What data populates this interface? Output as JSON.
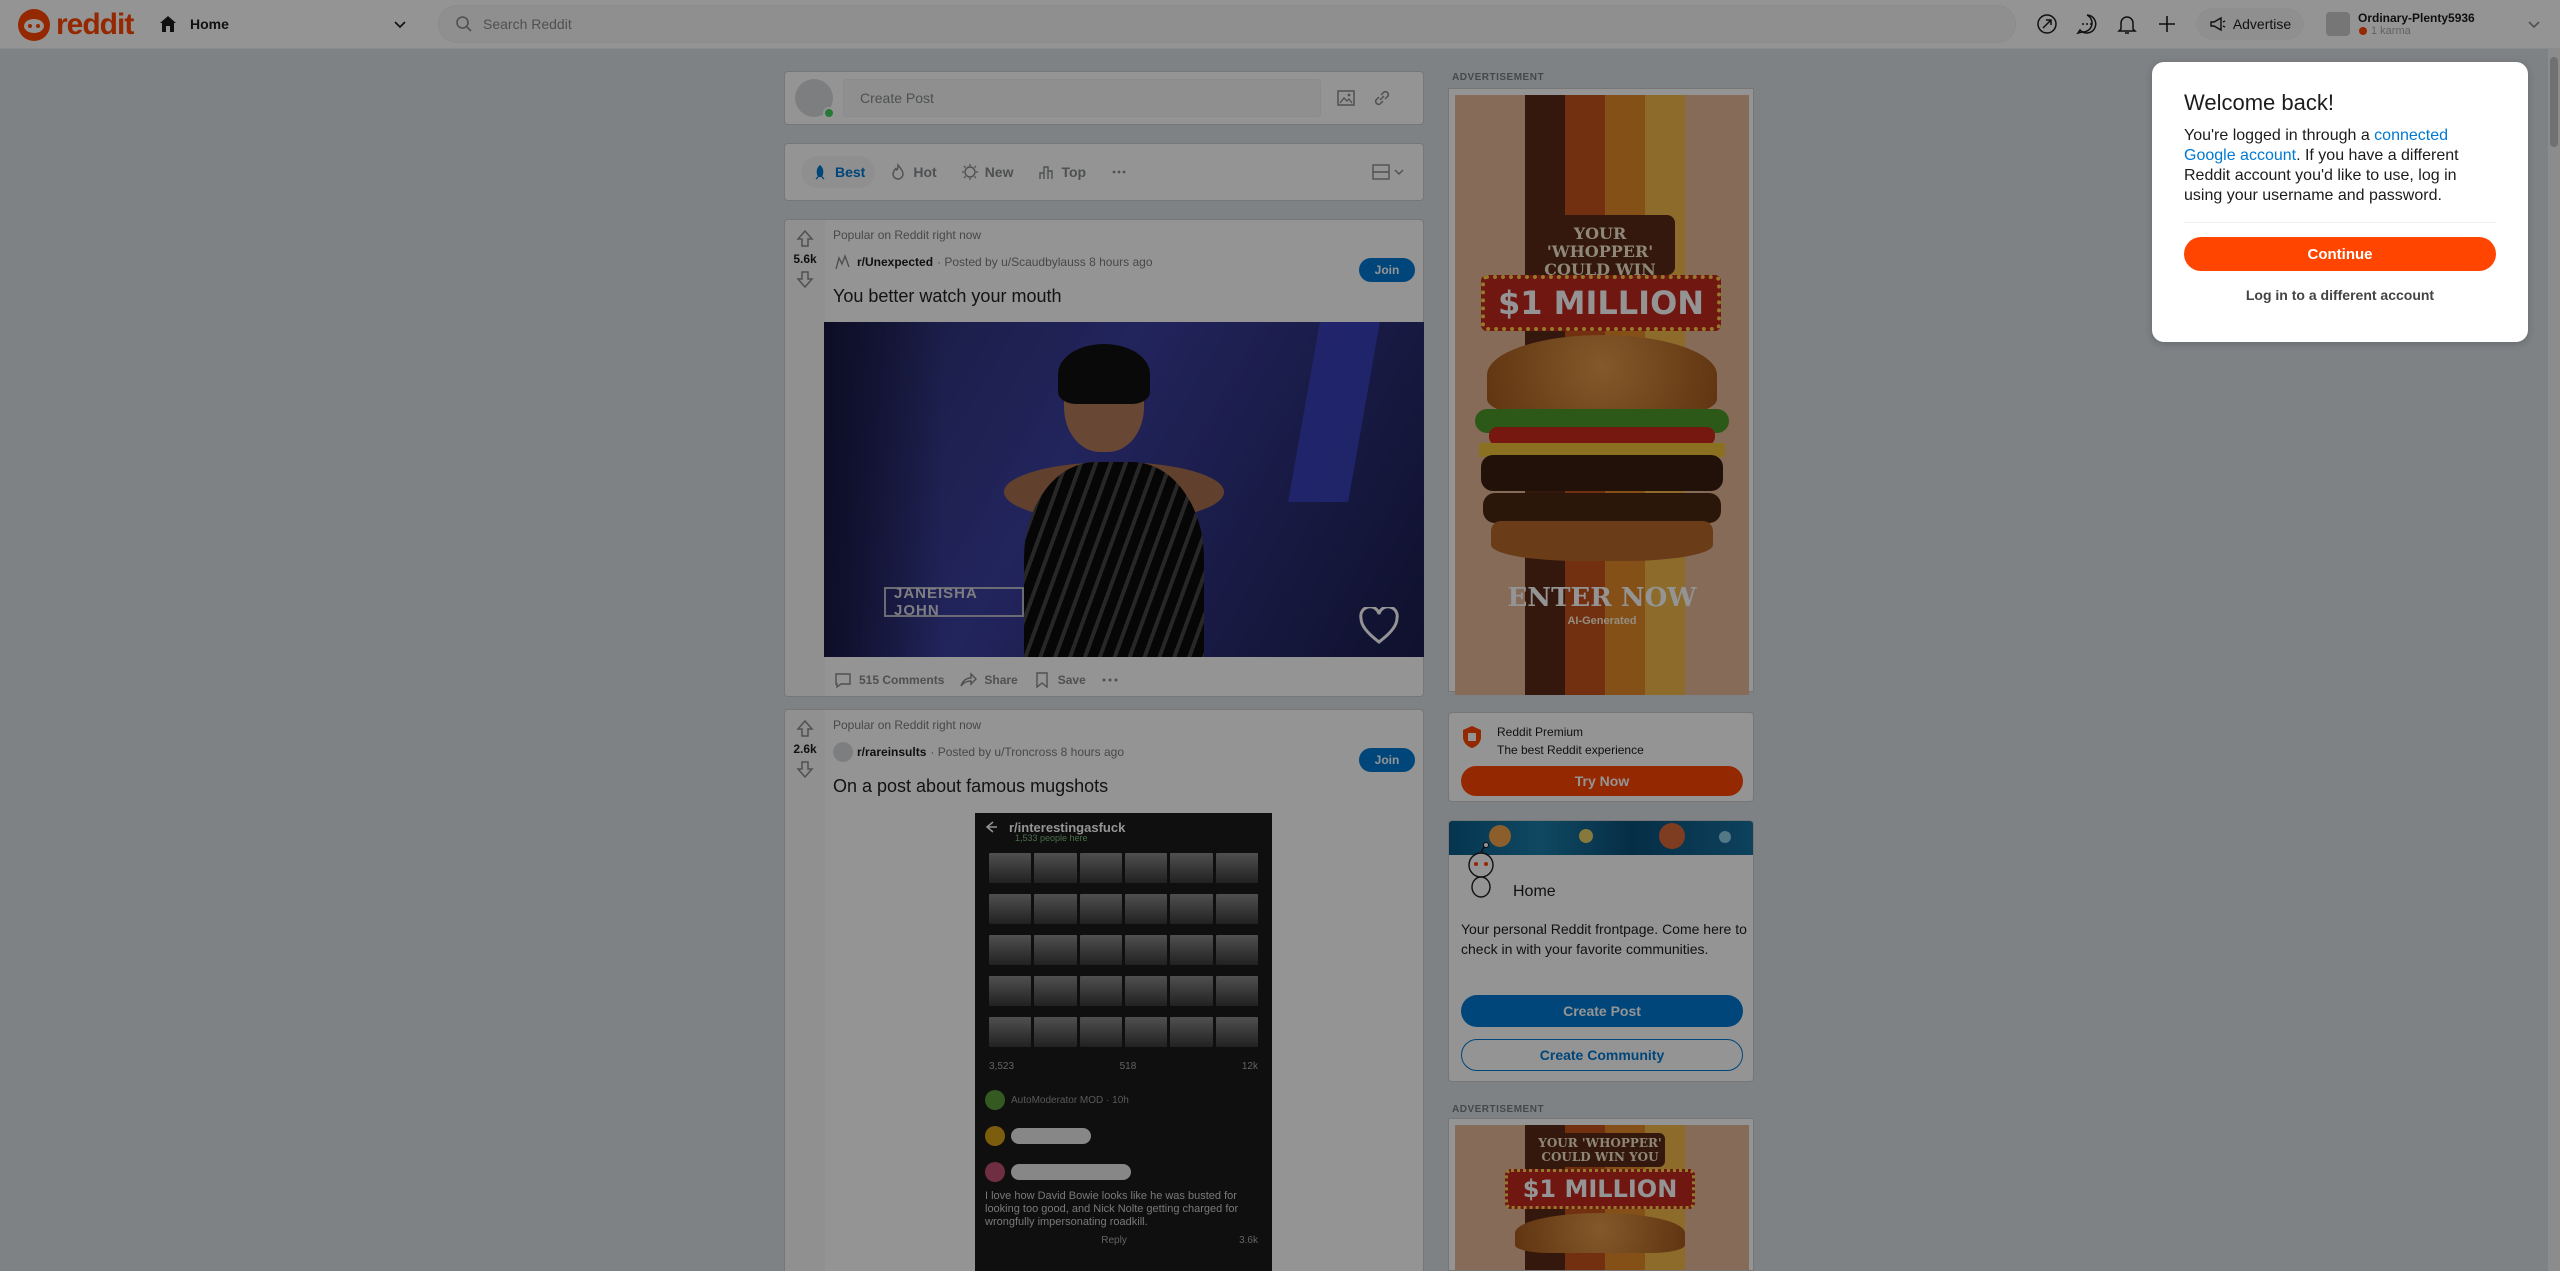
{
  "header": {
    "logo_text": "reddit",
    "home_label": "Home",
    "search_placeholder": "Search Reddit",
    "advertise_label": "Advertise",
    "username": "Ordinary-Plenty5936",
    "karma": "1 karma"
  },
  "create_post": {
    "placeholder": "Create Post"
  },
  "sort": {
    "items": [
      "Best",
      "Hot",
      "New",
      "Top"
    ],
    "active": "Best"
  },
  "posts": [
    {
      "label": "Popular on Reddit right now",
      "votes": "5.6k",
      "subreddit": "r/Unexpected",
      "posted_by": "· Posted by u/Scaudbylauss 8 hours ago",
      "join": "Join",
      "title": "You better watch your mouth",
      "video_caption": "JANEISHA JOHN",
      "comments": "515 Comments",
      "share": "Share",
      "save": "Save"
    },
    {
      "label": "Popular on Reddit right now",
      "votes": "2.6k",
      "subreddit": "r/rareinsults",
      "posted_by": "· Posted by u/Troncross 8 hours ago",
      "join": "Join",
      "title": "On a post about famous mugshots",
      "embed": {
        "community": "r/interestingasfuck",
        "online": "1,533 people here",
        "upvotes": "3,523",
        "comments": "518",
        "shares": "12k",
        "mod_line": "AutoModerator MOD · 10h",
        "comment_text": "I love how David Bowie looks like he was busted for looking too good, and Nick Nolte getting charged for wrongfully impersonating roadkill.",
        "reply": "Reply",
        "reply_votes": "3.6k"
      }
    }
  ],
  "sidebar": {
    "ad_label": "ADVERTISEMENT",
    "ad": {
      "headline": "YOUR 'WHOPPER' COULD WIN YOU",
      "prize": "$1 MILLION",
      "cta": "ENTER NOW",
      "note": "AI-Generated"
    },
    "premium": {
      "title": "Reddit Premium",
      "subtitle": "The best Reddit experience",
      "button": "Try Now"
    },
    "home": {
      "title": "Home",
      "description": "Your personal Reddit frontpage. Come here to check in with your favorite communities.",
      "create_post": "Create Post",
      "create_community": "Create Community"
    },
    "ad2_label": "ADVERTISEMENT"
  },
  "modal": {
    "title": "Welcome back!",
    "body_before": "You're logged in through a ",
    "link_text": "connected Google account",
    "body_after": ". If you have a different Reddit account you'd like to use, log in using your username and password.",
    "continue": "Continue",
    "other_account": "Log in to a different account"
  },
  "colors": {
    "brand": "#ff4500",
    "link": "#0079d3",
    "background": "#dae0e6"
  }
}
